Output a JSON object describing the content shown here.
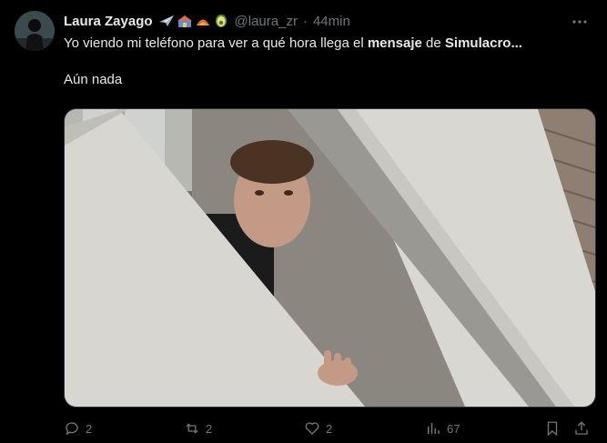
{
  "user": {
    "display_name": "Laura Zayago",
    "handle": "@laura_zr",
    "separator": "·",
    "time": "44min"
  },
  "tweet": {
    "text_before": "Yo viendo mi teléfono para ver a qué hora llega el ",
    "bold1": "mensaje",
    "text_mid": " de ",
    "bold2": "Simulacro",
    "ellipsis": "...",
    "line2": "Aún nada"
  },
  "actions": {
    "replies": "2",
    "retweets": "2",
    "likes": "2",
    "views": "67"
  },
  "icons": {
    "more": "more-dots-icon",
    "reply": "reply-icon",
    "retweet": "retweet-icon",
    "like": "heart-icon",
    "views": "views-bars-icon",
    "bookmark": "bookmark-icon",
    "share": "share-icon"
  },
  "colors": {
    "background": "#000000",
    "text": "#e7e9ea",
    "muted": "#71767b"
  }
}
